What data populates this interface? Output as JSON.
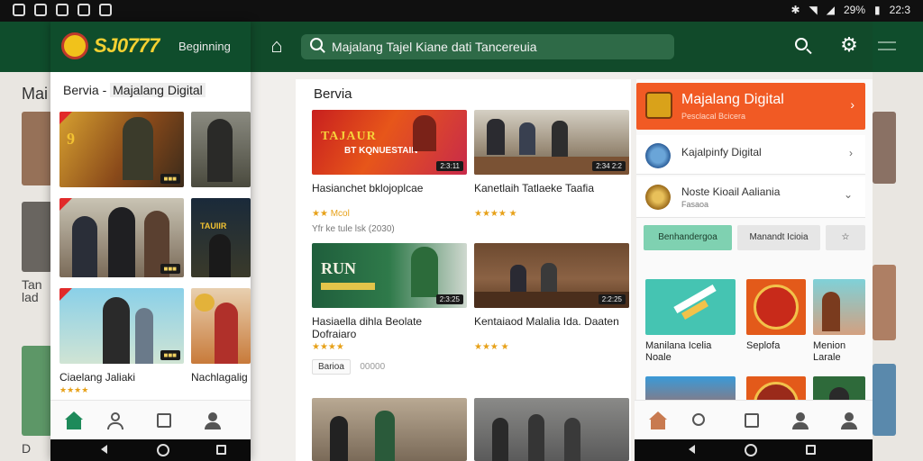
{
  "status_bar": {
    "battery": "29%",
    "time": "22:3"
  },
  "background_app": {
    "title": "Mai",
    "texts": [
      "Tan",
      "lad",
      "D"
    ]
  },
  "phone_left": {
    "logo_text": "SJ0777",
    "header_text": "Beginning",
    "section_title_prefix": "Bervia -",
    "section_title_highlight": "Majalang Digital",
    "card_badges": [
      "■■■",
      "■■■",
      "■■■"
    ],
    "card_captions": [
      "Ciaelang Jaliaki",
      "Nachlagalig"
    ],
    "card_rating": "★★★★",
    "tabs": [
      "home-icon",
      "profile-icon",
      "news-icon",
      "account-icon"
    ]
  },
  "middle_app": {
    "search_text": "Majalang Tajel Kiane dati Tancereuia",
    "section_title": "Bervia",
    "cards": [
      {
        "title": "Hasianchet bklojoplcae",
        "rating": "★★ Mcol",
        "extra": "Yfr ke tule lsk (2030)",
        "badge": "2:3:11",
        "thumb_text": "TAJAUR  \nBT KQNUESTAIN"
      },
      {
        "title": "Kanetlaih Tatlaeke Taafia",
        "rating": "★★★★ ★",
        "extra": "",
        "badge": "2:34 2:2",
        "thumb_text": ""
      },
      {
        "title": "Hasiaella dihla Beolate Dofraiaro",
        "rating": "★★★★",
        "extra": "",
        "badge": "2:3:25",
        "thumb_text": "RUN"
      },
      {
        "title": "Kentaiaod Malalia Ida. Daaten",
        "rating": "★★★ ★",
        "extra": "",
        "badge": "2:2:25",
        "thumb_text": ""
      }
    ],
    "chip_label": "Barioa",
    "chip_rating": "00000"
  },
  "right_panel": {
    "primary": {
      "title": "Majalang Digital",
      "subtitle": "Pesclacal Bcicera"
    },
    "items": [
      {
        "line1": "Kajalpinfy Digital",
        "line2": ""
      },
      {
        "line1": "Noste Kioail Aaliania",
        "line2": "Fasaoa"
      }
    ],
    "tabs": [
      "Benhandergoa",
      "Manandt Icioia",
      "☆"
    ],
    "tiles": [
      {
        "label": "Manilana Icelia Noale"
      },
      {
        "label": "Seplofa"
      },
      {
        "label": "Menion Larale"
      }
    ],
    "bottom_tabs": [
      "home-icon",
      "search-icon",
      "grid-icon",
      "profile-icon",
      "account-icon"
    ]
  },
  "colors": {
    "header_green": "#0f4d2c",
    "accent_orange": "#f15a24",
    "star": "#e7a119",
    "tab_green": "#7fd1b1"
  }
}
